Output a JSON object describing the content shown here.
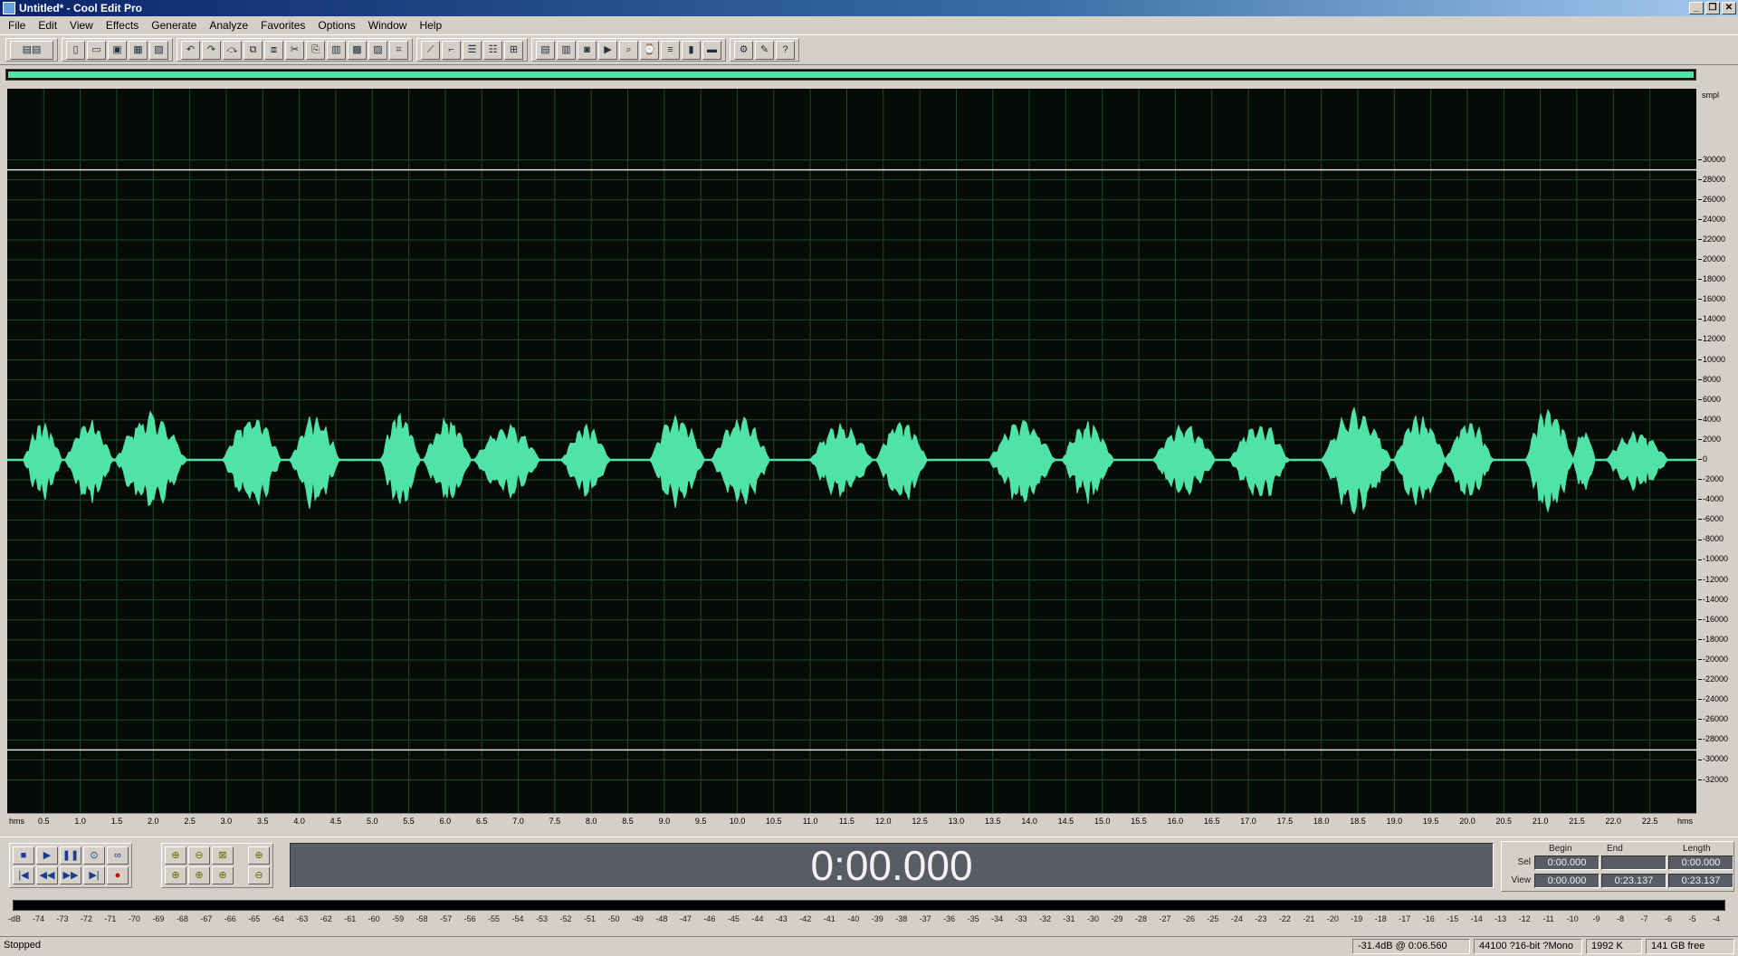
{
  "window": {
    "title": "Untitled* - Cool Edit Pro",
    "controls": [
      "_",
      "❐",
      "✕"
    ]
  },
  "menu": [
    "File",
    "Edit",
    "View",
    "Effects",
    "Generate",
    "Analyze",
    "Favorites",
    "Options",
    "Window",
    "Help"
  ],
  "waveform": {
    "colors": {
      "background": "#060b07",
      "grid": "#1f4a2a",
      "wave": "#4fe3a6",
      "clip_line": "#e0e0e0"
    },
    "y_unit": "smpl",
    "y_ticks": [
      "30000",
      "28000",
      "26000",
      "24000",
      "22000",
      "20000",
      "18000",
      "16000",
      "14000",
      "12000",
      "10000",
      "8000",
      "6000",
      "4000",
      "2000",
      "0",
      "-2000",
      "-4000",
      "-6000",
      "-8000",
      "-10000",
      "-12000",
      "-14000",
      "-16000",
      "-18000",
      "-20000",
      "-22000",
      "-24000",
      "-26000",
      "-28000",
      "-30000",
      "-32000"
    ],
    "x_unit": "hms",
    "x_ticks": [
      "0.5",
      "1.0",
      "1.5",
      "2.0",
      "2.5",
      "3.0",
      "3.5",
      "4.0",
      "4.5",
      "5.0",
      "5.5",
      "6.0",
      "6.5",
      "7.0",
      "7.5",
      "8.0",
      "8.5",
      "9.0",
      "9.5",
      "10.0",
      "10.5",
      "11.0",
      "11.5",
      "12.0",
      "12.5",
      "13.0",
      "13.5",
      "14.0",
      "14.5",
      "15.0",
      "15.5",
      "16.0",
      "16.5",
      "17.0",
      "17.5",
      "18.0",
      "18.5",
      "19.0",
      "19.5",
      "20.0",
      "20.5",
      "21.0",
      "21.5",
      "22.0",
      "22.5"
    ],
    "duration_seconds": 23.137,
    "bursts": [
      {
        "start": 0.22,
        "end": 0.75,
        "amp": 0.45
      },
      {
        "start": 0.8,
        "end": 1.45,
        "amp": 0.52
      },
      {
        "start": 1.48,
        "end": 2.45,
        "amp": 0.58
      },
      {
        "start": 2.95,
        "end": 3.75,
        "amp": 0.55
      },
      {
        "start": 3.88,
        "end": 4.55,
        "amp": 0.55
      },
      {
        "start": 5.12,
        "end": 5.65,
        "amp": 0.62
      },
      {
        "start": 5.7,
        "end": 6.35,
        "amp": 0.52
      },
      {
        "start": 6.4,
        "end": 7.3,
        "amp": 0.45
      },
      {
        "start": 7.6,
        "end": 8.25,
        "amp": 0.45
      },
      {
        "start": 8.8,
        "end": 9.55,
        "amp": 0.58
      },
      {
        "start": 9.65,
        "end": 10.45,
        "amp": 0.52
      },
      {
        "start": 11.0,
        "end": 11.85,
        "amp": 0.45
      },
      {
        "start": 11.9,
        "end": 12.6,
        "amp": 0.5
      },
      {
        "start": 13.45,
        "end": 14.35,
        "amp": 0.5
      },
      {
        "start": 14.45,
        "end": 15.15,
        "amp": 0.48
      },
      {
        "start": 15.7,
        "end": 16.55,
        "amp": 0.45
      },
      {
        "start": 16.75,
        "end": 17.55,
        "amp": 0.46
      },
      {
        "start": 18.0,
        "end": 18.95,
        "amp": 0.62
      },
      {
        "start": 19.0,
        "end": 19.7,
        "amp": 0.55
      },
      {
        "start": 19.7,
        "end": 20.35,
        "amp": 0.48
      },
      {
        "start": 20.8,
        "end": 21.45,
        "amp": 0.65
      },
      {
        "start": 21.45,
        "end": 21.75,
        "amp": 0.4
      },
      {
        "start": 21.9,
        "end": 22.75,
        "amp": 0.35
      }
    ]
  },
  "transport": {
    "row1": [
      "■",
      "▶",
      "❚❚",
      "⊙",
      "∞"
    ],
    "row2": [
      "|◀",
      "◀◀",
      "▶▶",
      "▶|",
      "●"
    ],
    "zoom_row1": [
      "⊕",
      "⊖",
      "⊠",
      "⊕"
    ],
    "zoom_row2": [
      "⊕",
      "⊕",
      "⊕",
      "⊖"
    ],
    "time": "0:00.000"
  },
  "selection_panel": {
    "headers": [
      "Begin",
      "End",
      "Length"
    ],
    "rows": [
      {
        "label": "Sel",
        "begin": "0:00.000",
        "end": "",
        "length": "0:00.000"
      },
      {
        "label": "View",
        "begin": "0:00.000",
        "end": "0:23.137",
        "length": "0:23.137"
      }
    ]
  },
  "level_meter": {
    "ticks": [
      "-dB",
      "-74",
      "-73",
      "-72",
      "-71",
      "-70",
      "-69",
      "-68",
      "-67",
      "-66",
      "-65",
      "-64",
      "-63",
      "-62",
      "-61",
      "-60",
      "-59",
      "-58",
      "-57",
      "-56",
      "-55",
      "-54",
      "-53",
      "-52",
      "-51",
      "-50",
      "-49",
      "-48",
      "-47",
      "-46",
      "-45",
      "-44",
      "-43",
      "-42",
      "-41",
      "-40",
      "-39",
      "-38",
      "-37",
      "-36",
      "-35",
      "-34",
      "-33",
      "-32",
      "-31",
      "-30",
      "-29",
      "-28",
      "-27",
      "-26",
      "-25",
      "-24",
      "-23",
      "-22",
      "-21",
      "-20",
      "-19",
      "-18",
      "-17",
      "-16",
      "-15",
      "-14",
      "-13",
      "-12",
      "-11",
      "-10",
      "-9",
      "-8",
      "-7",
      "-6",
      "-5",
      "-4"
    ]
  },
  "status": {
    "state": "Stopped",
    "cursor_level": "-31.4dB @  0:06.560",
    "format": "44100 ?16-bit ?Mono",
    "size": "1992 K",
    "free": "141 GB free"
  }
}
